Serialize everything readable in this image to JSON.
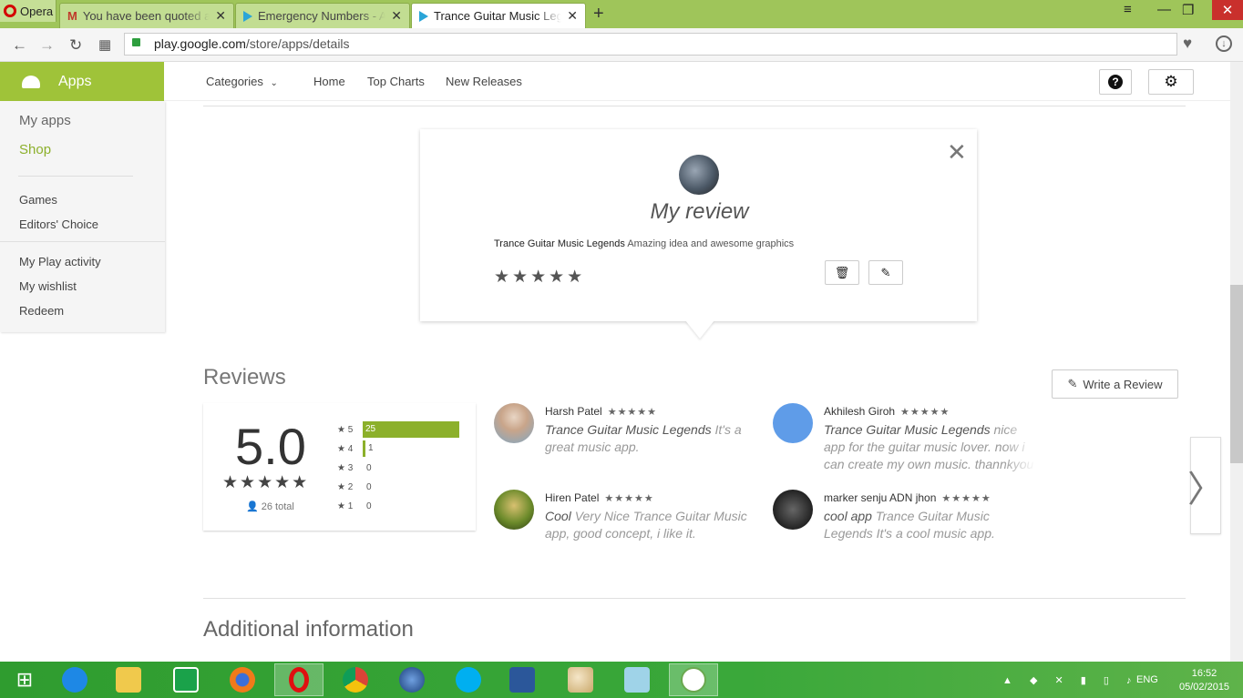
{
  "browser": {
    "opera_label": "Opera",
    "tabs": [
      {
        "title": "You have been quoted at t",
        "close": "✕"
      },
      {
        "title": "Emergency Numbers - An",
        "close": "✕"
      },
      {
        "title": "Trance Guitar Music Legends",
        "close": "✕"
      }
    ],
    "new_tab": "+",
    "url_domain": "play.google.com",
    "url_path": "/store/apps/details"
  },
  "sidebar": {
    "header": "Apps",
    "items": [
      "My apps",
      "Shop",
      "Games",
      "Editors' Choice",
      "My Play activity",
      "My wishlist",
      "Redeem"
    ]
  },
  "topnav": {
    "categories": "Categories",
    "home": "Home",
    "top_charts": "Top Charts",
    "new_releases": "New Releases",
    "help": "?"
  },
  "my_review": {
    "title": "My review",
    "app_name": "Trance Guitar Music Legends",
    "text": "Amazing idea and awesome graphics",
    "stars": "★★★★★",
    "close": "✕"
  },
  "reviews": {
    "title": "Reviews",
    "write_label": "Write a Review",
    "score": "5.0",
    "score_stars": "★★★★★",
    "total": "26 total",
    "histogram": [
      {
        "label": "★ 5",
        "count": "25",
        "fraction": 1.0
      },
      {
        "label": "★ 4",
        "count": "1",
        "fraction": 0.04
      },
      {
        "label": "★ 3",
        "count": "0",
        "fraction": 0
      },
      {
        "label": "★ 2",
        "count": "0",
        "fraction": 0
      },
      {
        "label": "★ 1",
        "count": "0",
        "fraction": 0
      }
    ],
    "items": [
      {
        "name": "Harsh Patel",
        "stars": "★★★★★",
        "title": "Trance Guitar Music Legends",
        "body": "It's a great music app."
      },
      {
        "name": "Akhilesh Giroh",
        "stars": "★★★★★",
        "title": "Trance Guitar Music Legends",
        "body": "nice app for the guitar music lover. now i can create my own music. thannkyou"
      },
      {
        "name": "Hiren Patel",
        "stars": "★★★★★",
        "title": "Cool",
        "body": "Very Nice Trance Guitar Music app, good concept, i like it."
      },
      {
        "name": "marker senju ADN jhon",
        "stars": "★★★★★",
        "title": "cool app",
        "body": "Trance Guitar Music Legends It's a cool music app."
      }
    ],
    "next": "〉"
  },
  "additional": "Additional information",
  "taskbar": {
    "lang": "ENG",
    "time": "16:52",
    "date": "05/02/2015"
  }
}
